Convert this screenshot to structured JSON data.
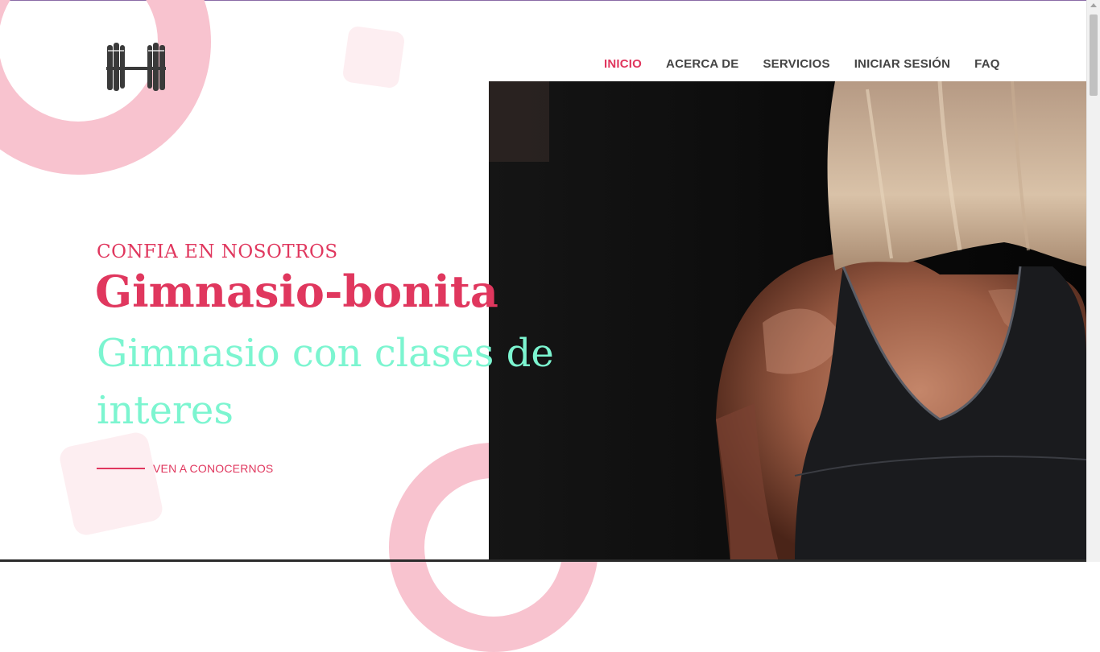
{
  "brand": {
    "logo_icon": "dumbbell-icon"
  },
  "nav": {
    "items": [
      {
        "label": "INICIO",
        "active": true
      },
      {
        "label": "ACERCA DE",
        "active": false
      },
      {
        "label": "SERVICIOS",
        "active": false
      },
      {
        "label": "INICIAR SESIÓN",
        "active": false
      },
      {
        "label": "FAQ",
        "active": false
      }
    ]
  },
  "hero": {
    "eyebrow": "CONFIA EN NOSOTROS",
    "title": "Gimnasio-bonita",
    "subtitle": "Gimnasio con clases de interes",
    "cta_label": "VEN A CONOCERNOS"
  },
  "colors": {
    "accent": "#e0375e",
    "mint": "#7cf5d0",
    "pink_shape": "#f8c3cf"
  }
}
